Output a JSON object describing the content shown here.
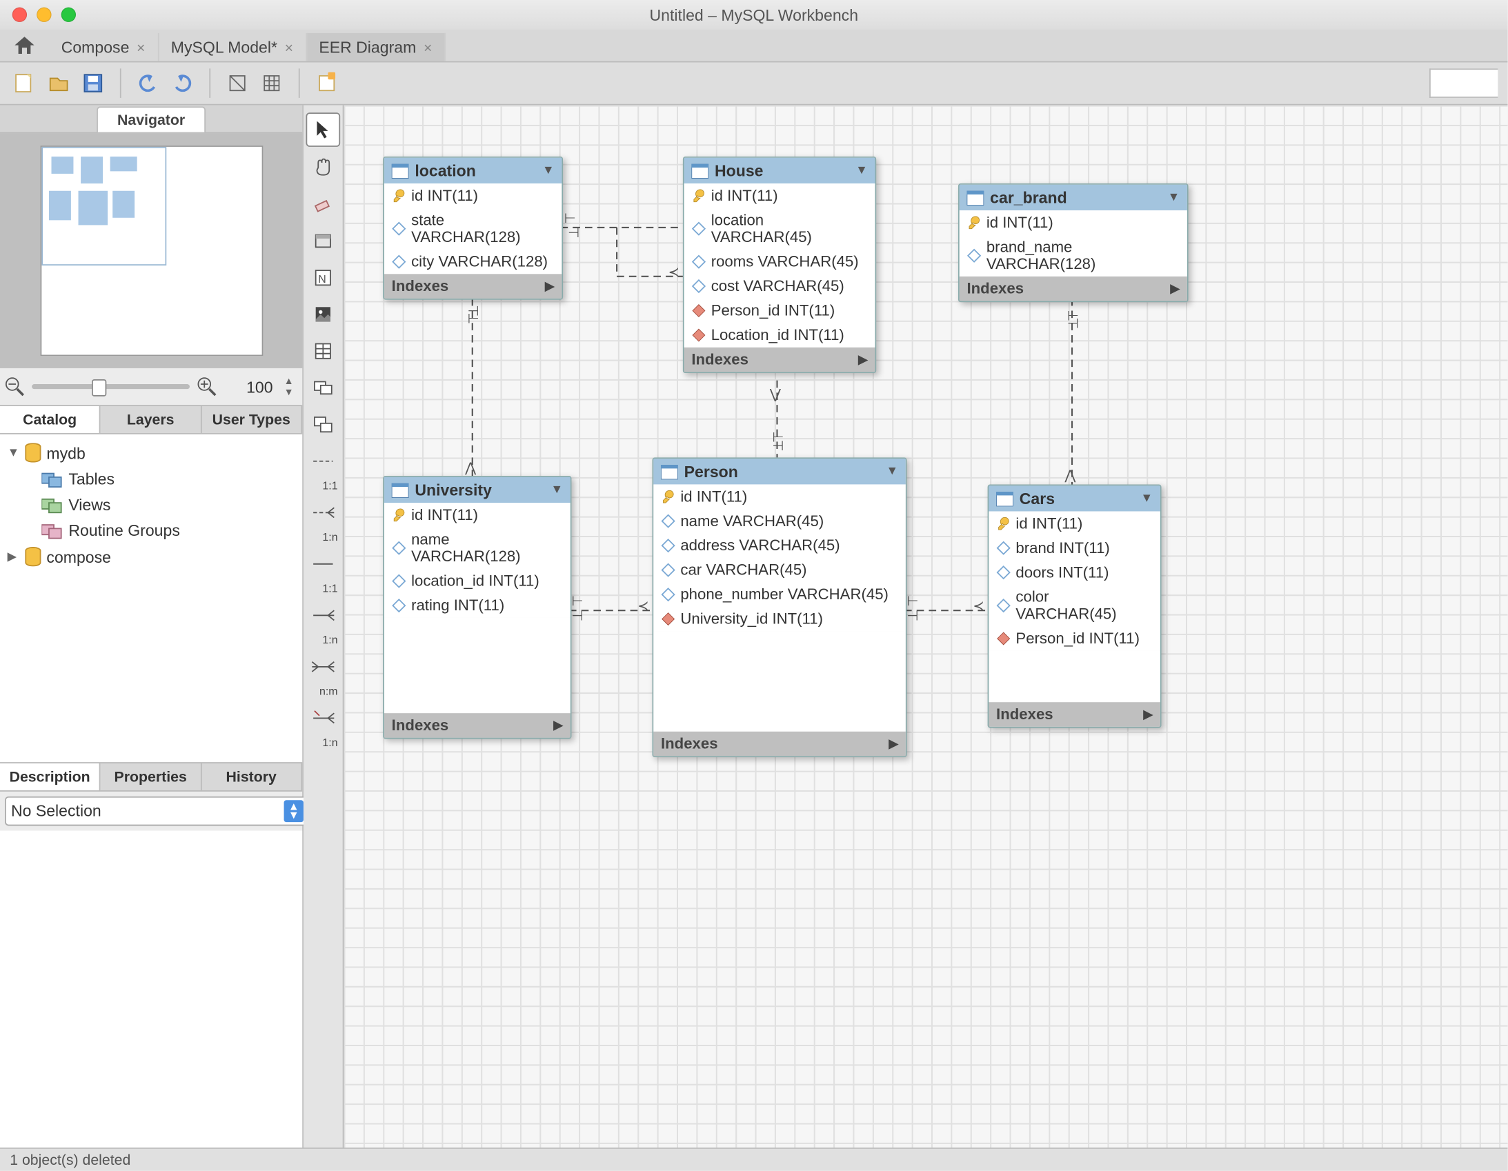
{
  "window_title": "Untitled – MySQL Workbench",
  "tabs": [
    {
      "label": "Compose",
      "closable": true
    },
    {
      "label": "MySQL Model*",
      "closable": true
    },
    {
      "label": "EER Diagram",
      "closable": true
    }
  ],
  "sidebar": {
    "navigator_label": "Navigator",
    "zoom_value": "100",
    "catalog_tabs": [
      "Catalog",
      "Layers",
      "User Types"
    ],
    "tree": {
      "db1": {
        "name": "mydb",
        "children": [
          "Tables",
          "Views",
          "Routine Groups"
        ]
      },
      "db2": {
        "name": "compose"
      }
    },
    "bottom_tabs": [
      "Description",
      "Properties",
      "History"
    ],
    "selection_combo": "No Selection"
  },
  "palette": {
    "rel_labels": [
      "1:1",
      "1:n",
      "1:1",
      "1:n",
      "n:m",
      "1:n"
    ]
  },
  "entities": {
    "location": {
      "name": "location",
      "cols": [
        {
          "n": "id INT(11)",
          "k": "pk"
        },
        {
          "n": "state VARCHAR(128)",
          "k": "col"
        },
        {
          "n": "city VARCHAR(128)",
          "k": "col"
        }
      ],
      "indexes": "Indexes"
    },
    "house": {
      "name": "House",
      "cols": [
        {
          "n": "id INT(11)",
          "k": "pk"
        },
        {
          "n": "location VARCHAR(45)",
          "k": "col"
        },
        {
          "n": "rooms VARCHAR(45)",
          "k": "col"
        },
        {
          "n": "cost VARCHAR(45)",
          "k": "col"
        },
        {
          "n": "Person_id INT(11)",
          "k": "fk"
        },
        {
          "n": "Location_id INT(11)",
          "k": "fk"
        }
      ],
      "indexes": "Indexes"
    },
    "car_brand": {
      "name": "car_brand",
      "cols": [
        {
          "n": "id INT(11)",
          "k": "pk"
        },
        {
          "n": "brand_name VARCHAR(128)",
          "k": "col"
        }
      ],
      "indexes": "Indexes"
    },
    "university": {
      "name": "University",
      "cols": [
        {
          "n": "id INT(11)",
          "k": "pk"
        },
        {
          "n": "name VARCHAR(128)",
          "k": "col"
        },
        {
          "n": "location_id INT(11)",
          "k": "col"
        },
        {
          "n": "rating INT(11)",
          "k": "col"
        }
      ],
      "indexes": "Indexes"
    },
    "person": {
      "name": "Person",
      "cols": [
        {
          "n": "id INT(11)",
          "k": "pk"
        },
        {
          "n": "name VARCHAR(45)",
          "k": "col"
        },
        {
          "n": "address VARCHAR(45)",
          "k": "col"
        },
        {
          "n": "car VARCHAR(45)",
          "k": "col"
        },
        {
          "n": "phone_number VARCHAR(45)",
          "k": "col"
        },
        {
          "n": "University_id INT(11)",
          "k": "fk"
        }
      ],
      "indexes": "Indexes"
    },
    "cars": {
      "name": "Cars",
      "cols": [
        {
          "n": "id INT(11)",
          "k": "pk"
        },
        {
          "n": "brand INT(11)",
          "k": "col"
        },
        {
          "n": "doors INT(11)",
          "k": "col"
        },
        {
          "n": "color VARCHAR(45)",
          "k": "col"
        },
        {
          "n": "Person_id INT(11)",
          "k": "fk"
        }
      ],
      "indexes": "Indexes"
    }
  },
  "status_bar": "1 object(s) deleted"
}
